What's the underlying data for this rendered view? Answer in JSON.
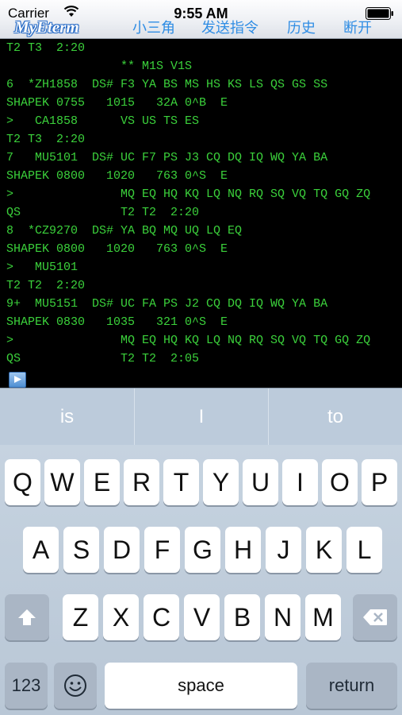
{
  "status_bar": {
    "carrier": "Carrier",
    "time": "9:55 AM"
  },
  "header": {
    "logo": "MyEterm",
    "buttons": [
      "小三角",
      "发送指令",
      "历史",
      "断开"
    ]
  },
  "terminal": {
    "lines": [
      "T2 T3  2:20",
      "                ** M1S V1S",
      "6  *ZH1858  DS# F3 YA BS MS HS KS LS QS GS SS",
      "SHAPEK 0755   1015   32A 0^B  E",
      ">   CA1858      VS US TS ES",
      "T2 T3  2:20",
      "7   MU5101  DS# UC F7 PS J3 CQ DQ IQ WQ YA BA",
      "SHAPEK 0800   1020   763 0^S  E",
      ">               MQ EQ HQ KQ LQ NQ RQ SQ VQ TQ GQ ZQ",
      "QS              T2 T2  2:20",
      "8  *CZ9270  DS# YA BQ MQ UQ LQ EQ",
      "SHAPEK 0800   1020   763 0^S  E",
      ">   MU5101",
      "T2 T2  2:20",
      "9+  MU5151  DS# UC FA PS J2 CQ DQ IQ WQ YA BA",
      "SHAPEK 0830   1035   321 0^S  E",
      ">               MQ EQ HQ KQ LQ NQ RQ SQ VQ TQ GQ ZQ",
      "QS              T2 T2  2:05"
    ]
  },
  "suggestions": [
    "is",
    "I",
    "to"
  ],
  "keyboard": {
    "row1": [
      "Q",
      "W",
      "E",
      "R",
      "T",
      "Y",
      "U",
      "I",
      "O",
      "P"
    ],
    "row2": [
      "A",
      "S",
      "D",
      "F",
      "G",
      "H",
      "J",
      "K",
      "L"
    ],
    "row3": [
      "Z",
      "X",
      "C",
      "V",
      "B",
      "N",
      "M"
    ],
    "numbers_label": "123",
    "space_label": "space",
    "return_label": "return"
  },
  "colors": {
    "terminal_text": "#3bd13b",
    "accent": "#2f8de4"
  }
}
